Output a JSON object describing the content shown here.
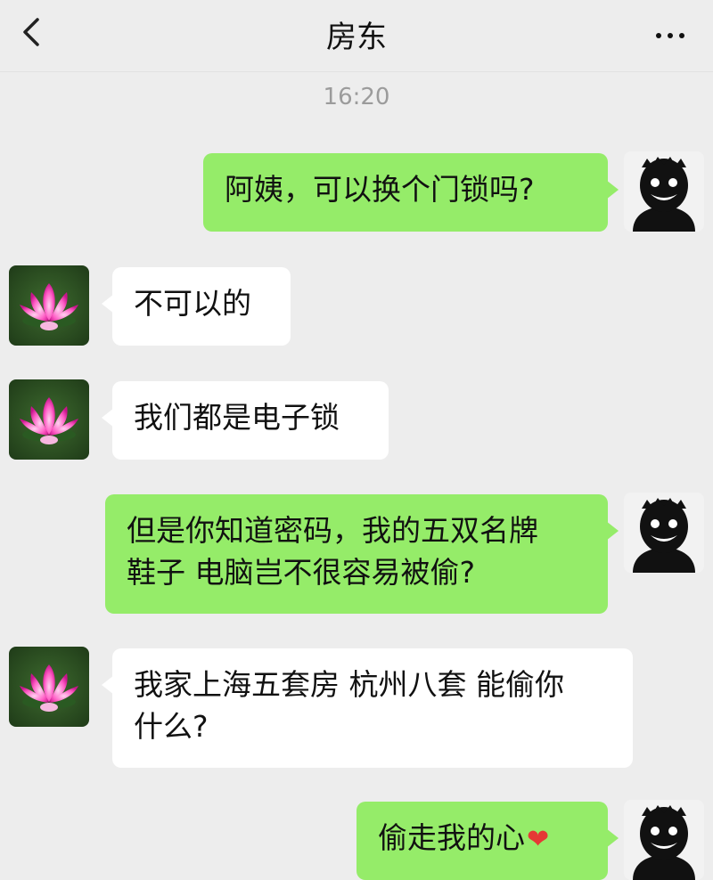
{
  "header": {
    "title": "房东",
    "back_icon": "chevron-left-icon",
    "more_icon": "more-dots-icon"
  },
  "chat": {
    "timestamp": "16:20",
    "messages": [
      {
        "sender": "me",
        "text": "阿姨，可以换个门锁吗?"
      },
      {
        "sender": "landlord",
        "text": "不可以的"
      },
      {
        "sender": "landlord",
        "text": "我们都是电子锁"
      },
      {
        "sender": "me",
        "line1": "但是你知道密码，我的五双名牌",
        "line2": "鞋子 电脑岂不很容易被偷?"
      },
      {
        "sender": "landlord",
        "line1": "我家上海五套房 杭州八套 能偷你",
        "line2": "什么?"
      },
      {
        "sender": "me",
        "text": "偷走我的心",
        "emoji": "❤"
      }
    ]
  },
  "colors": {
    "background": "#ededed",
    "my_bubble": "#95ec69",
    "their_bubble": "#ffffff",
    "timestamp": "#9b9b9b"
  },
  "avatars": {
    "me": "dark-shadow-face-avatar",
    "landlord": "pink-lotus-avatar"
  }
}
